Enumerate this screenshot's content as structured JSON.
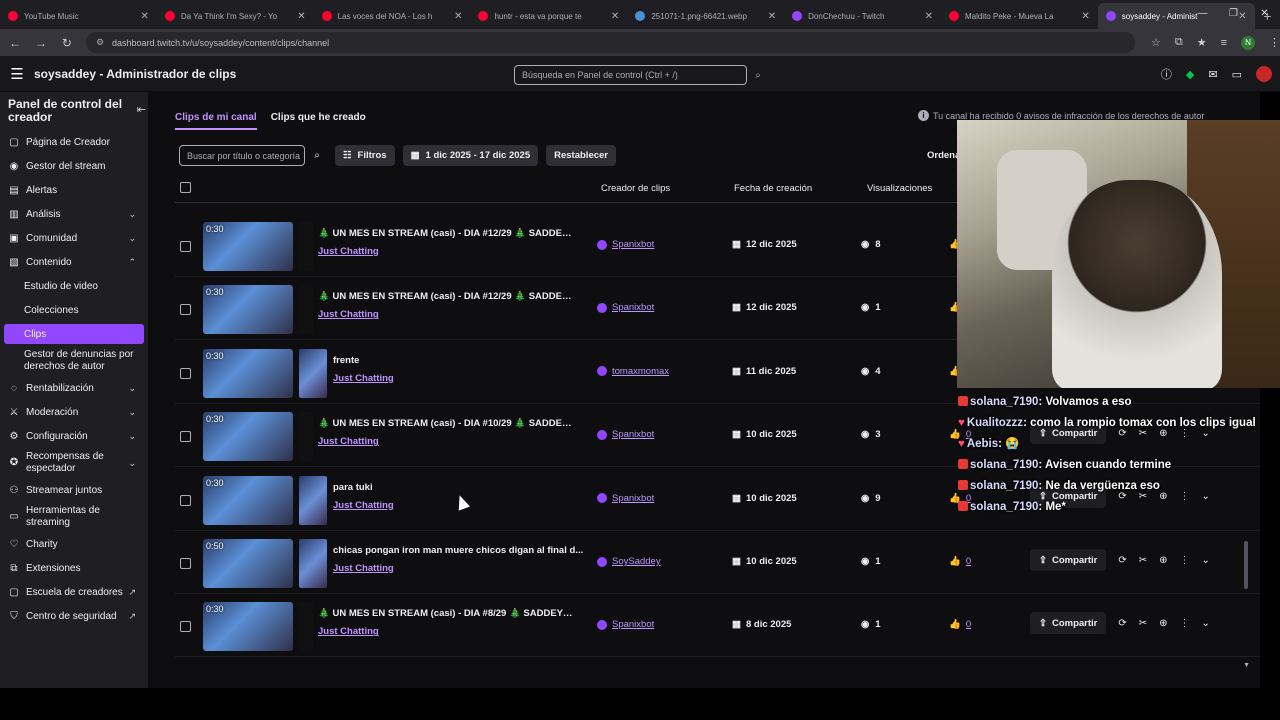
{
  "browser": {
    "tabs": [
      {
        "title": "YouTube Music",
        "color": "#ff0033",
        "active": false
      },
      {
        "title": "Da Ya Think I'm Sexy? - Yo",
        "color": "#ff0033",
        "active": false
      },
      {
        "title": "Las voces del NOA - Los h",
        "color": "#ff0033",
        "active": false
      },
      {
        "title": "huntr - esta va porque te",
        "color": "#ff0033",
        "active": false
      },
      {
        "title": "251071-1.png-66421.webp",
        "color": "#4a90d9",
        "active": false
      },
      {
        "title": "DonChechuu - Twitch",
        "color": "#9147ff",
        "active": false
      },
      {
        "title": "Maldito Peke - Mueva La",
        "color": "#ff0033",
        "active": false
      },
      {
        "title": "soysaddey - Administ",
        "color": "#9147ff",
        "active": true
      }
    ],
    "new_tab": "+",
    "url": "dashboard.twitch.tv/u/soysaddey/content/clips/channel",
    "profile_initial": "N"
  },
  "header": {
    "title": "soysaddey - Administrador de clips",
    "search_placeholder": "Búsqueda en Panel de control (Ctrl + /)"
  },
  "sidebar": {
    "heading": "Panel de control del creador",
    "items": [
      {
        "label": "Página de Creador",
        "icon": "home-icon"
      },
      {
        "label": "Gestor del stream",
        "icon": "stream-icon"
      },
      {
        "label": "Alertas",
        "icon": "alert-icon"
      },
      {
        "label": "Análisis",
        "icon": "chart-icon",
        "chevron": "down"
      },
      {
        "label": "Comunidad",
        "icon": "community-icon",
        "chevron": "down"
      },
      {
        "label": "Contenido",
        "icon": "content-icon",
        "chevron": "up"
      },
      {
        "label": "Estudio de video",
        "sub": true
      },
      {
        "label": "Colecciones",
        "sub": true
      },
      {
        "label": "Clips",
        "sub": true,
        "active": true
      },
      {
        "label": "Gestor de denuncias por derechos de autor",
        "sub": true
      },
      {
        "label": "Rentabilización",
        "icon": "money-icon",
        "chevron": "down"
      },
      {
        "label": "Moderación",
        "icon": "sword-icon",
        "chevron": "down"
      },
      {
        "label": "Configuración",
        "icon": "gear-icon",
        "chevron": "down"
      },
      {
        "label": "Recompensas de espectador",
        "icon": "reward-icon",
        "chevron": "down"
      },
      {
        "label": "Streamear juntos",
        "icon": "together-icon"
      },
      {
        "label": "Herramientas de streaming",
        "icon": "tools-icon"
      },
      {
        "label": "Charity",
        "icon": "charity-icon"
      },
      {
        "label": "Extensiones",
        "icon": "extension-icon"
      },
      {
        "label": "Escuela de creadores",
        "icon": "school-icon",
        "external": true
      },
      {
        "label": "Centro de seguridad",
        "icon": "shield-icon",
        "external": true
      }
    ]
  },
  "main": {
    "subtabs": [
      "Clips de mi canal",
      "Clips que he creado"
    ],
    "notice": "Tu canal ha recibido 0 avisos de infracción de los derechos de autor",
    "filter_search_placeholder": "Buscar por título o categoría",
    "filters_label": "Filtros",
    "date_range": "1 dic 2025 - 17 dic 2025",
    "reset_label": "Restablecer",
    "order_label": "Ordena",
    "columns": {
      "creator": "Creador de clips",
      "date": "Fecha de creación",
      "views": "Visualizaciones"
    },
    "share_label": "Compartir",
    "rows": [
      {
        "duration": "0:30",
        "title": "🎄 UN MES EN STREAM (casi) - DIA #12/29 🎄 SADDEY T...",
        "category": "Just Chatting",
        "creator": "Spanixbot",
        "date": "12 dic 2025",
        "views": "8",
        "likes": "",
        "wide": false
      },
      {
        "duration": "0:30",
        "title": "🎄 UN MES EN STREAM (casi) - DIA #12/29 🎄 SADDEY T...",
        "category": "Just Chatting",
        "creator": "Spanixbot",
        "date": "12 dic 2025",
        "views": "1",
        "likes": "",
        "wide": false
      },
      {
        "duration": "0:30",
        "title": "frente",
        "category": "Just Chatting",
        "creator": "tomaxmomax",
        "date": "11 dic 2025",
        "views": "4",
        "likes": "",
        "wide": true
      },
      {
        "duration": "0:30",
        "title": "🎄 UN MES EN STREAM (casi) - DIA #10/29 🎄 SADDEY...",
        "category": "Just Chatting",
        "creator": "Spanixbot",
        "date": "10 dic 2025",
        "views": "3",
        "likes": "0",
        "wide": false
      },
      {
        "duration": "0:30",
        "title": "para tuki",
        "category": "Just Chatting",
        "creator": "Spanixbot",
        "date": "10 dic 2025",
        "views": "9",
        "likes": "0",
        "wide": true
      },
      {
        "duration": "0:50",
        "title": "chicas pongan iron man muere chicos digan al final d...",
        "category": "Just Chatting",
        "creator": "SoySaddey",
        "date": "10 dic 2025",
        "views": "1",
        "likes": "0",
        "wide": true
      },
      {
        "duration": "0:30",
        "title": "🎄 UN MES EN STREAM (casi) - DIA #8/29 🎄 SADDEY T...",
        "category": "Just Chatting",
        "creator": "Spanixbot",
        "date": "8 dic 2025",
        "views": "1",
        "likes": "0",
        "wide": false
      }
    ]
  },
  "overlay_chat": [
    {
      "user": "solana_7190",
      "msg": "Volvamos a eso",
      "badge": "box"
    },
    {
      "user": "Kualitozzz",
      "msg": "como la rompio tomax con los clips igual",
      "badge": "heart"
    },
    {
      "user": "Aebis",
      "msg": "😭",
      "badge": "heart"
    },
    {
      "user": "solana_7190",
      "msg": "Avisen cuando termine",
      "badge": "box"
    },
    {
      "user": "solana_7190",
      "msg": "Ne da vergüenza eso",
      "badge": "box"
    },
    {
      "user": "solana_7190",
      "msg": "Me*",
      "badge": "box"
    }
  ],
  "colors": {
    "accent": "#9147ff",
    "link": "#bf94ff",
    "bg": "#0e0e10",
    "sidebar": "#1f1f23"
  }
}
